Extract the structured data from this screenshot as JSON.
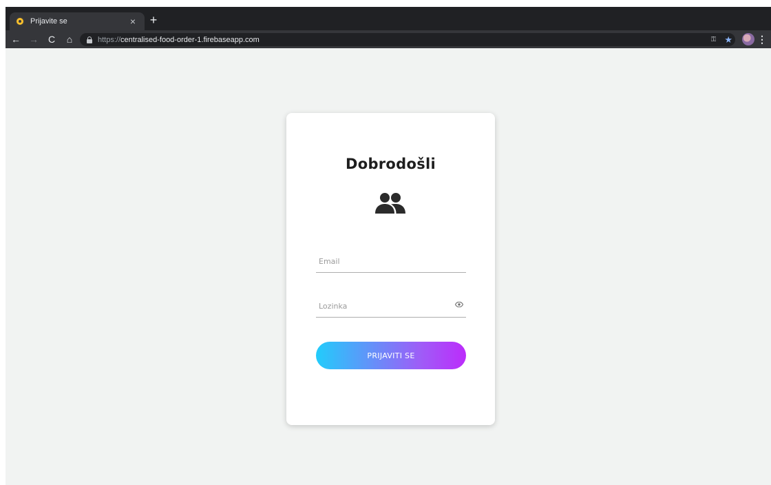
{
  "browser": {
    "tab_title": "Prijavite se",
    "tab_close": "×",
    "new_tab": "+",
    "back": "←",
    "forward": "→",
    "reload": "C",
    "home": "⌂",
    "url_scheme": "https://",
    "url_host": "centralised-food-order-1.firebaseapp.com",
    "key_glyph": "⚿",
    "star_glyph": "★",
    "menu_glyph": "⋮"
  },
  "login": {
    "title": "Dobrodošli",
    "email_placeholder": "Email",
    "password_placeholder": "Lozinka",
    "submit_label": "PRIJAVITI SE"
  },
  "colors": {
    "page_background": "#f1f3f2",
    "button_gradient_start": "#22ccfb",
    "button_gradient_end": "#bc2cfb",
    "title_color": "#1e1e1e"
  },
  "icons": {
    "users": "users-icon",
    "eye": "eye-icon",
    "lock": "lock-icon"
  }
}
